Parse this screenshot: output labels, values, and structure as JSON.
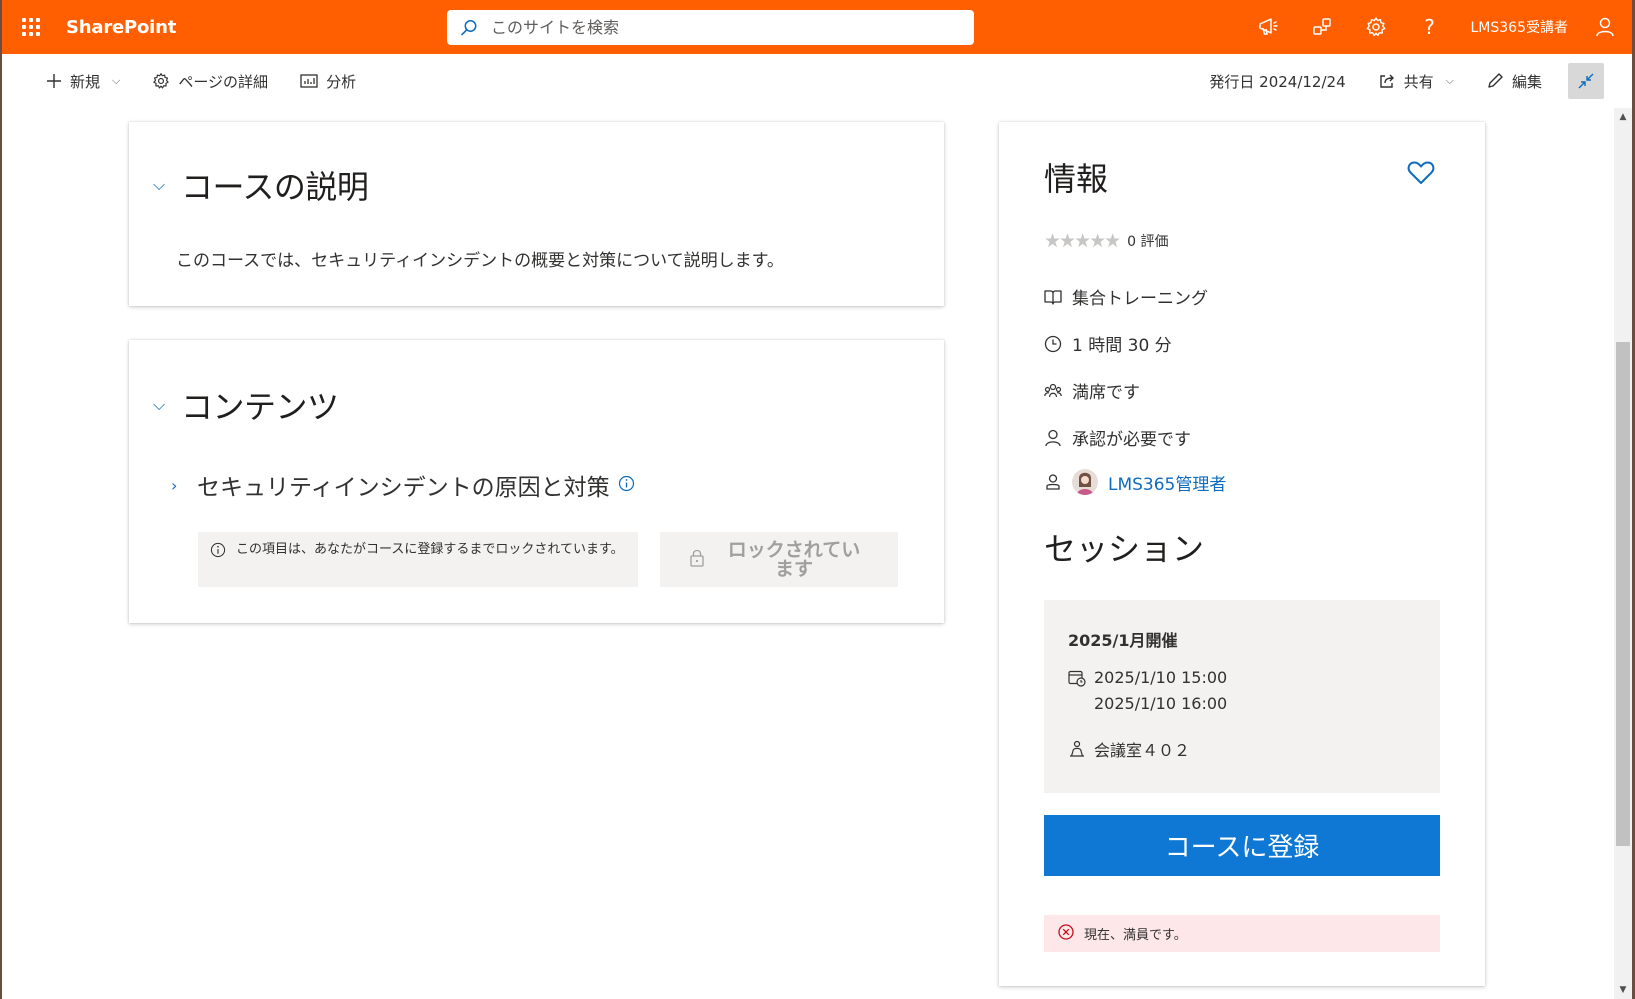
{
  "suite": {
    "app_name": "SharePoint",
    "search_placeholder": "このサイトを検索",
    "user_name": "LMS365受講者"
  },
  "commandbar": {
    "new_label": "新規",
    "page_details_label": "ページの詳細",
    "analytics_label": "分析",
    "published": "発行日 2024/12/24",
    "share_label": "共有",
    "edit_label": "編集"
  },
  "description_section": {
    "title": "コースの説明",
    "text": "このコースでは、セキュリティインシデントの概要と対策について説明します。"
  },
  "contents_section": {
    "title": "コンテンツ",
    "items": [
      {
        "title": "セキュリティインシデントの原因と対策",
        "lock_note": "この項目は、あなたがコースに登録するまでロックされています。",
        "lock_button": "ロックされています"
      }
    ]
  },
  "info_panel": {
    "title": "情報",
    "rating_text": "0 評価",
    "rating_value": 0,
    "rating_max": 5,
    "training_type": "集合トレーニング",
    "duration": "1 時間 30 分",
    "capacity": "満席です",
    "approval": "承認が必要です",
    "instructor": "LMS365管理者",
    "session_heading": "セッション",
    "session": {
      "name": "2025/1月開催",
      "start": "2025/1/10 15:00",
      "end": "2025/1/10 16:00",
      "location": "会議室４０２"
    },
    "register_button": "コースに登録",
    "error_message": "現在、満員です。"
  },
  "colors": {
    "suite_bar": "#ff5f00",
    "accent": "#0f78d4",
    "link": "#0f6cbd",
    "error_bg": "#fde7e9",
    "error_icon": "#c50f1f"
  }
}
